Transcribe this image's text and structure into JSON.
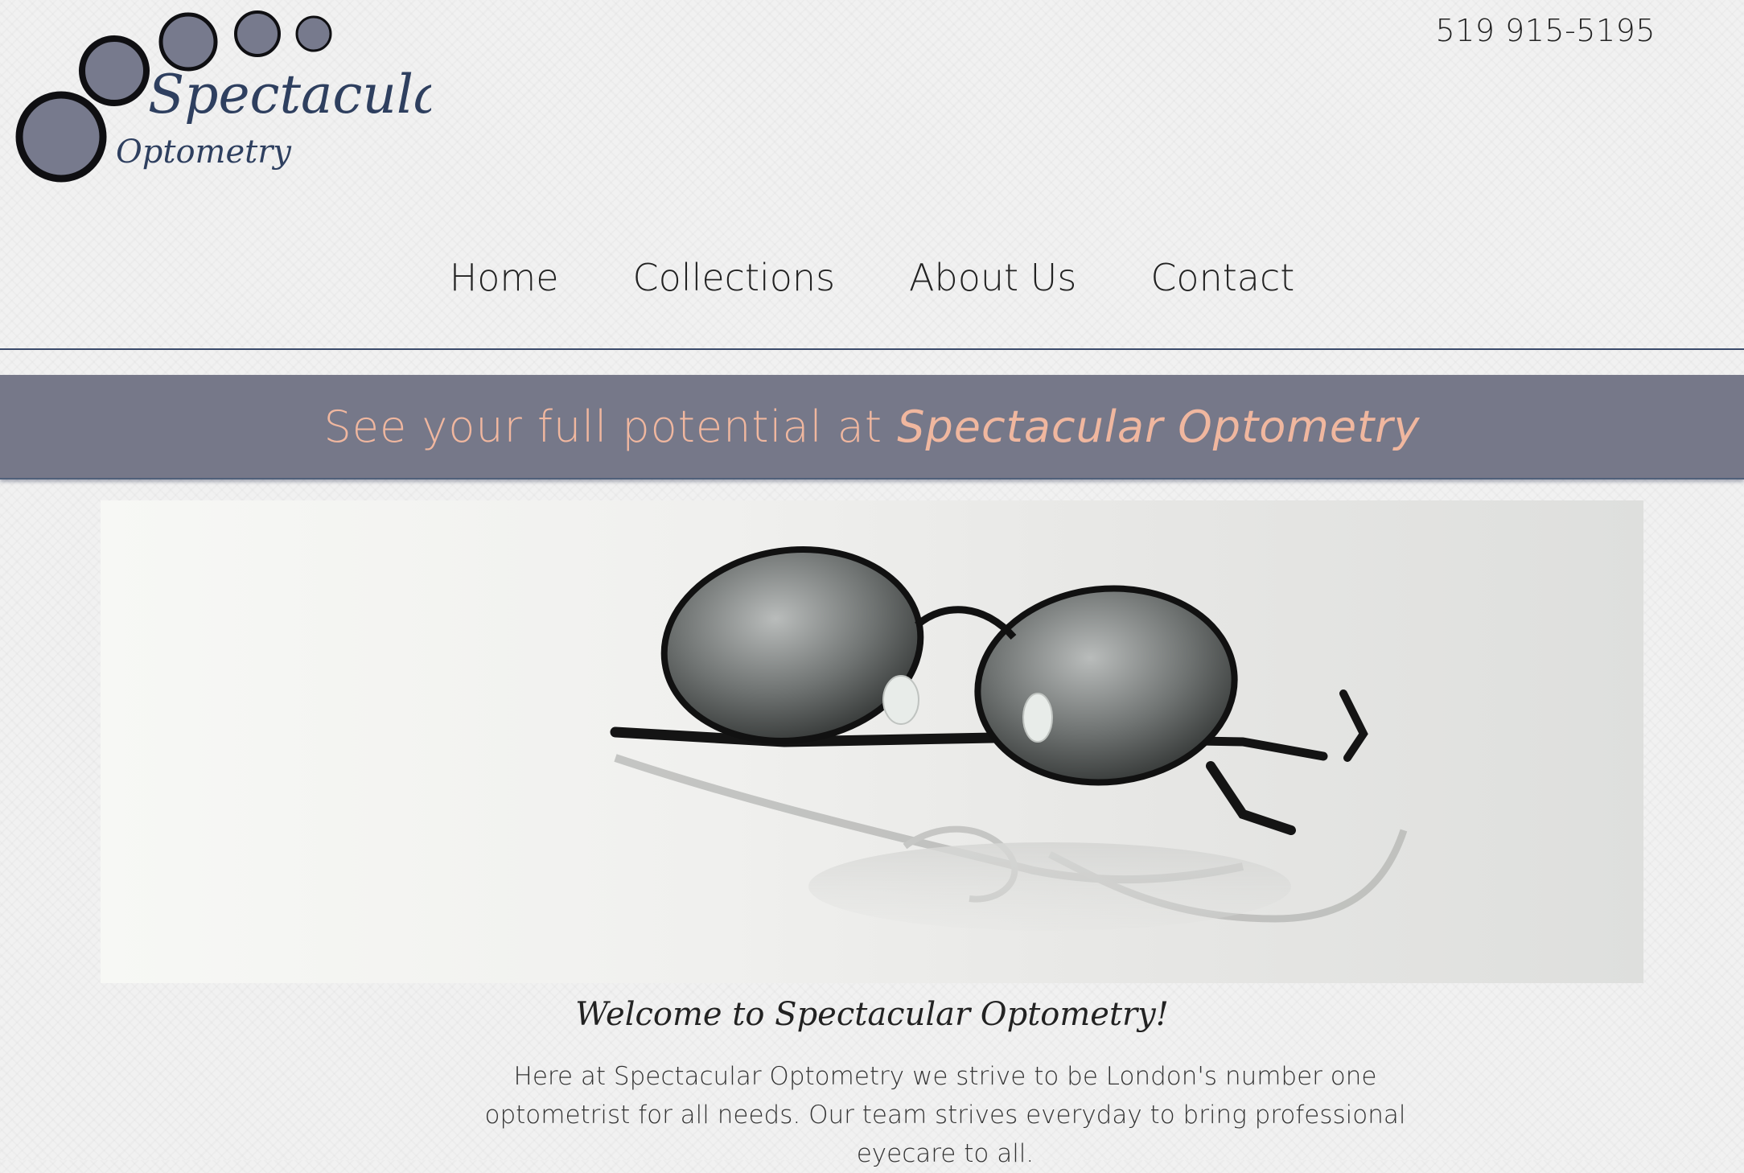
{
  "header": {
    "logo": {
      "brand_line1": "Spectacular",
      "brand_line2": "Optometry",
      "colors": {
        "circle_fill": "#777a8d",
        "circle_stroke": "#0f0f12",
        "brand_text": "#2e3f5f"
      }
    },
    "phone": "519 915-5195"
  },
  "nav": {
    "items": [
      {
        "label": "Home"
      },
      {
        "label": "Collections"
      },
      {
        "label": "About Us"
      },
      {
        "label": "Contact"
      }
    ]
  },
  "banner": {
    "text_plain": "See your full potential at",
    "text_emphasis": "Spectacular Optometry",
    "colors": {
      "background": "#767889",
      "text": "#f0b79f"
    }
  },
  "hero": {
    "subject": "round-sunglasses-photo"
  },
  "content": {
    "welcome": "Welcome to Spectacular Optometry!",
    "intro": "Here at Spectacular Optometry we strive to be London's number one optometrist for all needs. Our team strives everyday to bring professional eyecare to all."
  }
}
